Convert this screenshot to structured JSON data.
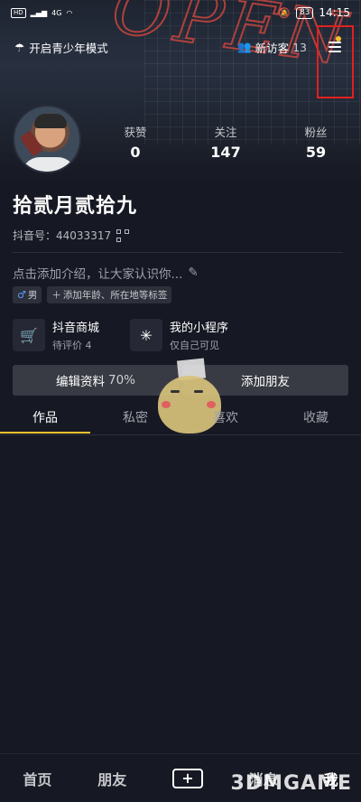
{
  "status_bar": {
    "time": "14:15",
    "battery": "83",
    "network": "4G"
  },
  "header": {
    "teen_mode_label": "开启青少年模式",
    "new_visitors_label": "新访客",
    "new_visitors_count": "13"
  },
  "profile": {
    "name": "拾贰月贰拾九",
    "douyin_id_label": "抖音号：",
    "douyin_id": "44033317",
    "bio_placeholder": "点击添加介绍，让大家认识你...",
    "gender_tag": "男",
    "add_tags_label": "添加年龄、所在地等标签"
  },
  "stats": [
    {
      "label": "获赞",
      "value": "0"
    },
    {
      "label": "关注",
      "value": "147"
    },
    {
      "label": "粉丝",
      "value": "59"
    }
  ],
  "shortcuts": [
    {
      "title": "抖音商城",
      "subtitle": "待评价 4"
    },
    {
      "title": "我的小程序",
      "subtitle": "仅自己可见"
    }
  ],
  "buttons": {
    "edit_profile": "编辑资料",
    "edit_profile_percent": "70%",
    "add_friends": "添加朋友"
  },
  "tabs": [
    "作品",
    "私密",
    "喜欢",
    "收藏"
  ],
  "bottom_nav": {
    "home": "首页",
    "friends": "朋友",
    "create": "+",
    "messages": "消息",
    "me": "我"
  },
  "watermark": "3DMGAME",
  "colors": {
    "background": "#161823",
    "accent": "#f6c32c",
    "highlight_box": "#e02020"
  }
}
